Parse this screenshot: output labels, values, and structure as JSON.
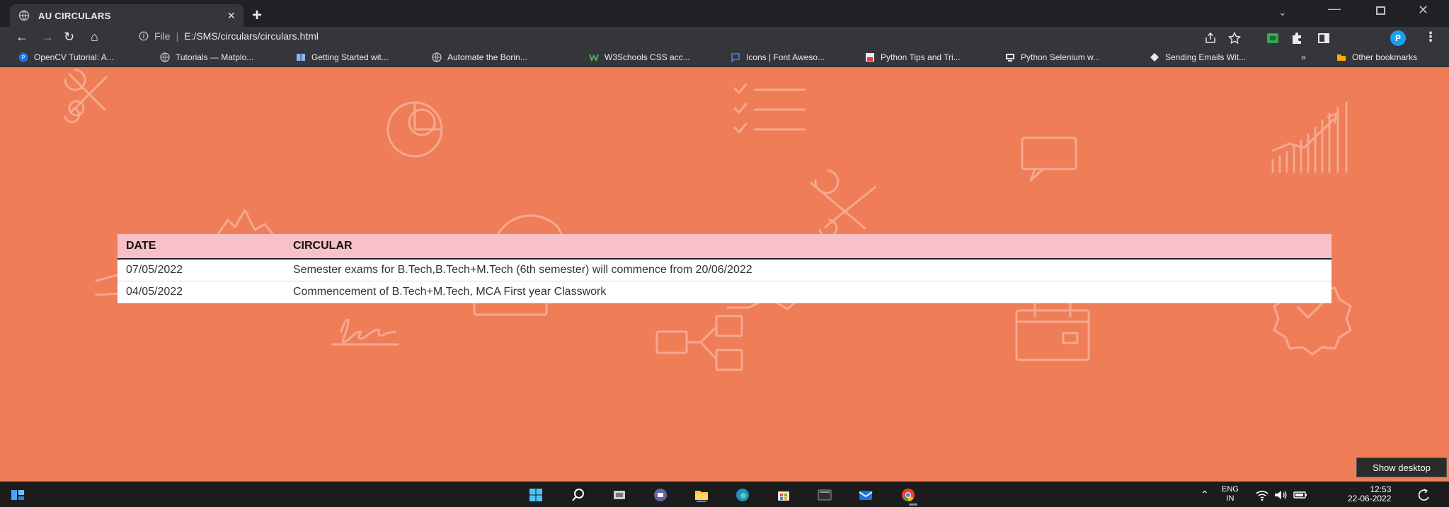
{
  "browser": {
    "tab_title": "AU CIRCULARS",
    "tab_close": "×",
    "new_tab": "+",
    "url_scheme": "File",
    "url_separator": "|",
    "url": "E:/SMS/circulars/circulars.html",
    "profile_initial": "P"
  },
  "bookmarks": {
    "items": [
      {
        "label": "OpenCV Tutorial: A...",
        "icon": "opencv-icon",
        "color": "#1a73e8"
      },
      {
        "label": "Tutorials — Matplo...",
        "icon": "globe-icon",
        "color": "#bdc1c6"
      },
      {
        "label": "Getting Started wit...",
        "icon": "book-icon",
        "color": "#8ab4f8"
      },
      {
        "label": "Automate the Borin...",
        "icon": "globe-icon",
        "color": "#bdc1c6"
      },
      {
        "label": "W3Schools CSS acc...",
        "icon": "w3schools-icon",
        "color": "#4caf50"
      },
      {
        "label": "Icons | Font Aweso...",
        "icon": "flag-icon",
        "color": "#4285f4"
      },
      {
        "label": "Python Tips and Tri...",
        "icon": "python-tips-icon",
        "color": "#e53935"
      },
      {
        "label": "Python Selenium w...",
        "icon": "monitor-icon",
        "color": "#e8eaed"
      },
      {
        "label": "Sending Emails Wit...",
        "icon": "diamond-icon",
        "color": "#e8eaed"
      }
    ],
    "overflow": "»",
    "other_label": "Other bookmarks"
  },
  "table": {
    "headers": {
      "date": "DATE",
      "circular": "CIRCULAR"
    },
    "rows": [
      {
        "date": "07/05/2022",
        "circular": "Semester exams for B.Tech,B.Tech+M.Tech (6th semester) will commence from 20/06/2022"
      },
      {
        "date": "04/05/2022",
        "circular": "Commencement of B.Tech+M.Tech, MCA First year Classwork"
      }
    ]
  },
  "tooltip": {
    "show_desktop": "Show desktop"
  },
  "taskbar": {
    "lang_top": "ENG",
    "lang_bottom": "IN",
    "time": "12:53",
    "date": "22-06-2022"
  },
  "colors": {
    "page_bg": "#ef7d58",
    "header_row": "#f7c1c7",
    "chrome_dark": "#202124",
    "chrome_toolbar": "#35363a"
  }
}
